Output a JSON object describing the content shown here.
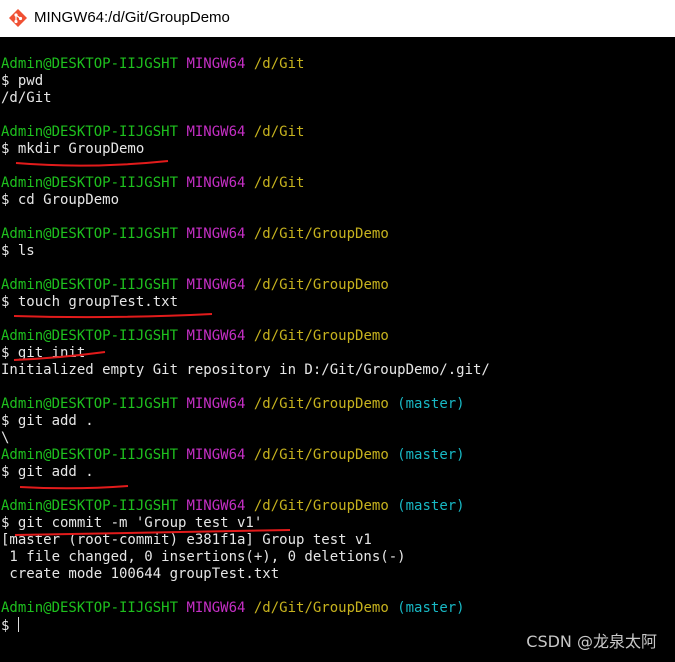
{
  "window": {
    "title": "MINGW64:/d/Git/GroupDemo",
    "icon": "git-bash-icon"
  },
  "colors": {
    "user": "#1ec11e",
    "system": "#c52fc5",
    "path": "#c6b21e",
    "branch": "#18b8c4",
    "text": "#e6e6e6",
    "annotation": "#e21b1b"
  },
  "prompt": {
    "user": "Admin@DESKTOP-IIJGSHT",
    "system": "MINGW64"
  },
  "lines": [
    {
      "type": "prompt",
      "path": "/d/Git",
      "branch": ""
    },
    {
      "type": "text",
      "text": "$ pwd"
    },
    {
      "type": "text",
      "text": "/d/Git"
    },
    {
      "type": "prompt",
      "path": "/d/Git",
      "branch": ""
    },
    {
      "type": "text",
      "text": "$ mkdir GroupDemo"
    },
    {
      "type": "prompt",
      "path": "/d/Git",
      "branch": ""
    },
    {
      "type": "text",
      "text": "$ cd GroupDemo"
    },
    {
      "type": "prompt",
      "path": "/d/Git/GroupDemo",
      "branch": ""
    },
    {
      "type": "text",
      "text": "$ ls"
    },
    {
      "type": "prompt",
      "path": "/d/Git/GroupDemo",
      "branch": ""
    },
    {
      "type": "text",
      "text": "$ touch groupTest.txt"
    },
    {
      "type": "prompt",
      "path": "/d/Git/GroupDemo",
      "branch": ""
    },
    {
      "type": "text",
      "text": "$ git init"
    },
    {
      "type": "text",
      "text": "Initialized empty Git repository in D:/Git/GroupDemo/.git/"
    },
    {
      "type": "prompt",
      "path": "/d/Git/GroupDemo",
      "branch": "(master)"
    },
    {
      "type": "text",
      "text": "$ git add ."
    },
    {
      "type": "text",
      "text": "\\"
    },
    {
      "type": "prompt",
      "path": "/d/Git/GroupDemo",
      "branch": "(master)"
    },
    {
      "type": "text",
      "text": "$ git add ."
    },
    {
      "type": "prompt",
      "path": "/d/Git/GroupDemo",
      "branch": "(master)"
    },
    {
      "type": "text",
      "text": "$ git commit -m 'Group test v1'"
    },
    {
      "type": "text",
      "text": "[master (root-commit) e381f1a] Group test v1"
    },
    {
      "type": "text",
      "text": " 1 file changed, 0 insertions(+), 0 deletions(-)"
    },
    {
      "type": "text",
      "text": " create mode 100644 groupTest.txt"
    },
    {
      "type": "prompt",
      "path": "/d/Git/GroupDemo",
      "branch": "(master)"
    },
    {
      "type": "input",
      "text": "$ "
    }
  ],
  "watermark": "CSDN @龙泉太阿"
}
